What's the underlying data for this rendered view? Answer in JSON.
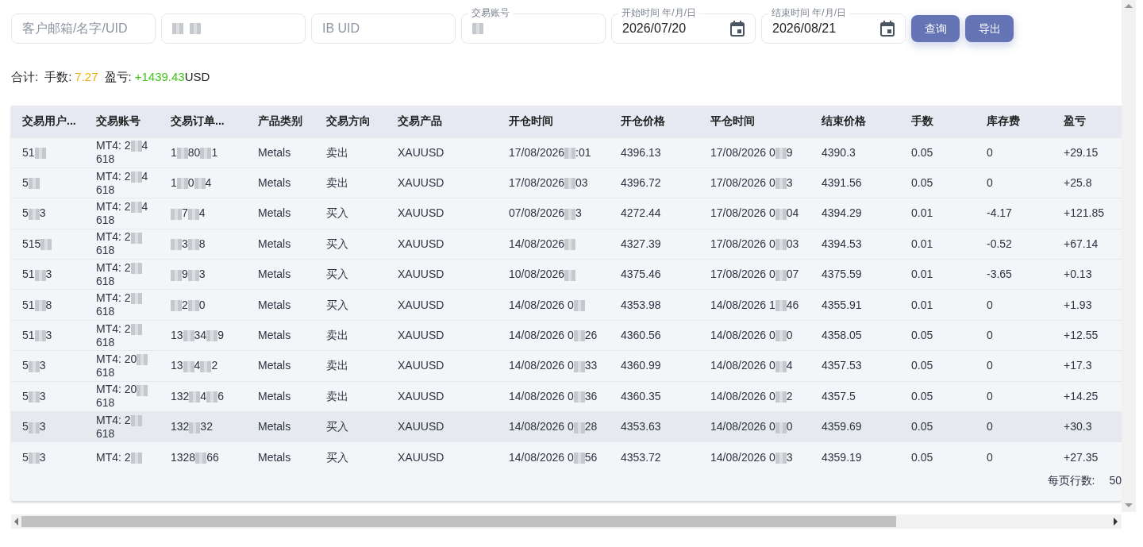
{
  "filters": [
    {
      "kind": "text",
      "placeholder": "客户邮箱/名字/UID"
    },
    {
      "kind": "redacted",
      "parts": [
        {
          "kind": "blur"
        },
        {
          "kind": "blur"
        }
      ]
    },
    {
      "kind": "text",
      "placeholder": "IB UID"
    },
    {
      "kind": "redacted",
      "label": "交易账号",
      "parts": [
        {
          "kind": "blur"
        }
      ]
    },
    {
      "kind": "date",
      "label": "开始时间 年/月/日",
      "value": "2026/07/20"
    },
    {
      "kind": "date",
      "label": "结束时间 年/月/日",
      "value": "2026/08/21"
    }
  ],
  "buttons": [
    "查询",
    "导出"
  ],
  "summary": {
    "label": "合计:",
    "lots_label": "手数:",
    "lots": "7.27",
    "pnl_label": "盈亏:",
    "pnl": "+1439.43",
    "currency": "USD"
  },
  "table": {
    "columns": [
      "交易用户...",
      "交易账号",
      "交易订单...",
      "产品类别",
      "交易方向",
      "交易产品",
      "开仓时间",
      "开仓价格",
      "平仓时间",
      "结束价格",
      "手数",
      "库存费",
      "盈亏"
    ],
    "rows": [
      {
        "highlighted": false,
        "user": [
          "51",
          {
            "kind": "blur"
          }
        ],
        "account": [
          [
            "MT4: 2",
            {
              "kind": "blur"
            },
            "4"
          ],
          [
            "618"
          ]
        ],
        "order": [
          "1",
          {
            "kind": "blur"
          },
          "80",
          {
            "kind": "blur"
          },
          "1"
        ],
        "category": "Metals",
        "direction": "卖出",
        "product": "XAUUSD",
        "open_time": [
          "17/08/2026",
          {
            "kind": "blur"
          },
          ":01"
        ],
        "open_price": "4396.13",
        "close_time": [
          "17/08/2026 0",
          {
            "kind": "blur"
          },
          "9"
        ],
        "close_price": "4390.3",
        "lots": "0.05",
        "swap": "0",
        "pnl": "+29.15"
      },
      {
        "highlighted": false,
        "user": [
          "5",
          {
            "kind": "blur"
          }
        ],
        "account": [
          [
            "MT4: 2",
            {
              "kind": "blur"
            },
            "4"
          ],
          [
            "618"
          ]
        ],
        "order": [
          "1",
          {
            "kind": "blur"
          },
          "0",
          {
            "kind": "blur"
          },
          "4"
        ],
        "category": "Metals",
        "direction": "卖出",
        "product": "XAUUSD",
        "open_time": [
          "17/08/2026",
          {
            "kind": "blur"
          },
          "03"
        ],
        "open_price": "4396.72",
        "close_time": [
          "17/08/2026 0",
          {
            "kind": "blur"
          },
          "3"
        ],
        "close_price": "4391.56",
        "lots": "0.05",
        "swap": "0",
        "pnl": "+25.8"
      },
      {
        "highlighted": false,
        "user": [
          "5",
          {
            "kind": "blur"
          },
          "3"
        ],
        "account": [
          [
            "MT4: 2",
            {
              "kind": "blur"
            },
            "4"
          ],
          [
            "618"
          ]
        ],
        "order": [
          {
            "kind": "blur"
          },
          "7",
          {
            "kind": "blur"
          },
          "4"
        ],
        "category": "Metals",
        "direction": "买入",
        "product": "XAUUSD",
        "open_time": [
          "07/08/2026",
          {
            "kind": "blur"
          },
          "3"
        ],
        "open_price": "4272.44",
        "close_time": [
          "17/08/2026 0",
          {
            "kind": "blur"
          },
          "04"
        ],
        "close_price": "4394.29",
        "lots": "0.01",
        "swap": "-4.17",
        "pnl": "+121.85"
      },
      {
        "highlighted": false,
        "user": [
          "515",
          {
            "kind": "blur"
          }
        ],
        "account": [
          [
            "MT4: 2",
            {
              "kind": "blur"
            }
          ],
          [
            "618"
          ]
        ],
        "order": [
          {
            "kind": "blur"
          },
          "3",
          {
            "kind": "blur"
          },
          "8"
        ],
        "category": "Metals",
        "direction": "买入",
        "product": "XAUUSD",
        "open_time": [
          "14/08/2026",
          {
            "kind": "blur"
          }
        ],
        "open_price": "4327.39",
        "close_time": [
          "17/08/2026 0",
          {
            "kind": "blur"
          },
          "03"
        ],
        "close_price": "4394.53",
        "lots": "0.01",
        "swap": "-0.52",
        "pnl": "+67.14"
      },
      {
        "highlighted": false,
        "user": [
          "51",
          {
            "kind": "blur"
          },
          "3"
        ],
        "account": [
          [
            "MT4: 2",
            {
              "kind": "blur"
            }
          ],
          [
            "618"
          ]
        ],
        "order": [
          {
            "kind": "blur"
          },
          "9",
          {
            "kind": "blur"
          },
          "3"
        ],
        "category": "Metals",
        "direction": "买入",
        "product": "XAUUSD",
        "open_time": [
          "10/08/2026",
          {
            "kind": "blur"
          }
        ],
        "open_price": "4375.46",
        "close_time": [
          "17/08/2026 0",
          {
            "kind": "blur"
          },
          "07"
        ],
        "close_price": "4375.59",
        "lots": "0.01",
        "swap": "-3.65",
        "pnl": "+0.13"
      },
      {
        "highlighted": false,
        "user": [
          "51",
          {
            "kind": "blur"
          },
          "8"
        ],
        "account": [
          [
            "MT4: 2",
            {
              "kind": "blur"
            }
          ],
          [
            "618"
          ]
        ],
        "order": [
          {
            "kind": "blur"
          },
          "2",
          {
            "kind": "blur"
          },
          "0"
        ],
        "category": "Metals",
        "direction": "买入",
        "product": "XAUUSD",
        "open_time": [
          "14/08/2026 0",
          {
            "kind": "blur"
          }
        ],
        "open_price": "4353.98",
        "close_time": [
          "14/08/2026 1",
          {
            "kind": "blur"
          },
          "46"
        ],
        "close_price": "4355.91",
        "lots": "0.01",
        "swap": "0",
        "pnl": "+1.93"
      },
      {
        "highlighted": false,
        "user": [
          "51",
          {
            "kind": "blur"
          },
          "3"
        ],
        "account": [
          [
            "MT4: 2",
            {
              "kind": "blur"
            }
          ],
          [
            "618"
          ]
        ],
        "order": [
          "13",
          {
            "kind": "blur"
          },
          "34",
          {
            "kind": "blur"
          },
          "9"
        ],
        "category": "Metals",
        "direction": "卖出",
        "product": "XAUUSD",
        "open_time": [
          "14/08/2026 0",
          {
            "kind": "blur"
          },
          "26"
        ],
        "open_price": "4360.56",
        "close_time": [
          "14/08/2026 0",
          {
            "kind": "blur"
          },
          "0"
        ],
        "close_price": "4358.05",
        "lots": "0.05",
        "swap": "0",
        "pnl": "+12.55"
      },
      {
        "highlighted": false,
        "user": [
          "5",
          {
            "kind": "blur"
          },
          "3"
        ],
        "account": [
          [
            "MT4: 20",
            {
              "kind": "blur"
            }
          ],
          [
            "618"
          ]
        ],
        "order": [
          "13",
          {
            "kind": "blur"
          },
          "4",
          {
            "kind": "blur"
          },
          "2"
        ],
        "category": "Metals",
        "direction": "卖出",
        "product": "XAUUSD",
        "open_time": [
          "14/08/2026 0",
          {
            "kind": "blur"
          },
          "33"
        ],
        "open_price": "4360.99",
        "close_time": [
          "14/08/2026 0",
          {
            "kind": "blur"
          },
          "4"
        ],
        "close_price": "4357.53",
        "lots": "0.05",
        "swap": "0",
        "pnl": "+17.3"
      },
      {
        "highlighted": false,
        "user": [
          "5",
          {
            "kind": "blur"
          },
          "3"
        ],
        "account": [
          [
            "MT4: 20",
            {
              "kind": "blur"
            }
          ],
          [
            "618"
          ]
        ],
        "order": [
          "132",
          {
            "kind": "blur"
          },
          "4",
          {
            "kind": "blur"
          },
          "6"
        ],
        "category": "Metals",
        "direction": "卖出",
        "product": "XAUUSD",
        "open_time": [
          "14/08/2026 0",
          {
            "kind": "blur"
          },
          "36"
        ],
        "open_price": "4360.35",
        "close_time": [
          "14/08/2026 0",
          {
            "kind": "blur"
          },
          "2"
        ],
        "close_price": "4357.5",
        "lots": "0.05",
        "swap": "0",
        "pnl": "+14.25"
      },
      {
        "highlighted": true,
        "user": [
          "5",
          {
            "kind": "blur"
          },
          "3"
        ],
        "account": [
          [
            "MT4: 2",
            {
              "kind": "blur"
            }
          ],
          [
            "618"
          ]
        ],
        "order": [
          "132",
          {
            "kind": "blur"
          },
          "32"
        ],
        "category": "Metals",
        "direction": "买入",
        "product": "XAUUSD",
        "open_time": [
          "14/08/2026 0",
          {
            "kind": "blur"
          },
          "28"
        ],
        "open_price": "4353.63",
        "close_time": [
          "14/08/2026 0",
          {
            "kind": "blur"
          },
          "0"
        ],
        "close_price": "4359.69",
        "lots": "0.05",
        "swap": "0",
        "pnl": "+30.3"
      },
      {
        "highlighted": false,
        "user": [
          "5",
          {
            "kind": "blur"
          },
          "3"
        ],
        "account": [
          [
            "MT4: 2",
            {
              "kind": "blur"
            }
          ]
        ],
        "order": [
          "1328",
          {
            "kind": "blur"
          },
          "66"
        ],
        "category": "Metals",
        "direction": "买入",
        "product": "XAUUSD",
        "open_time": [
          "14/08/2026 0",
          {
            "kind": "blur"
          },
          "56"
        ],
        "open_price": "4353.72",
        "close_time": [
          "14/08/2026 0",
          {
            "kind": "blur"
          },
          "3"
        ],
        "close_price": "4359.19",
        "lots": "0.05",
        "swap": "0",
        "pnl": "+27.35"
      }
    ]
  },
  "pagination": {
    "label": "每页行数:",
    "value": "50"
  }
}
